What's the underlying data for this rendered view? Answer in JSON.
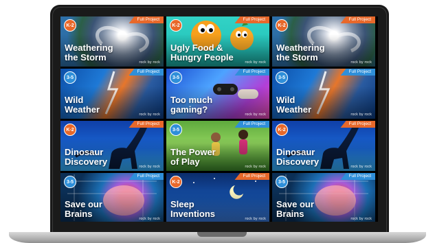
{
  "colors": {
    "ribbon_k2": "#e8682a",
    "ribbon_35": "#2f8fd9",
    "grade_k2": "#e8682a",
    "grade_35": "#2f8fd9"
  },
  "cards": [
    {
      "grade": "K-2",
      "badge": "Full Project",
      "title_line1": "Weathering",
      "title_line2": "the Storm",
      "brand": "rock by rock",
      "theme": "storm"
    },
    {
      "grade": "K-2",
      "badge": "Full Project",
      "title_line1": "Ugly Food &",
      "title_line2": "Hungry People",
      "brand": "rock by rock",
      "theme": "food"
    },
    {
      "grade": "K-2",
      "badge": "Full Project",
      "title_line1": "Weathering",
      "title_line2": "the Storm",
      "brand": "rock by rock",
      "theme": "storm"
    },
    {
      "grade": "3-5",
      "badge": "Full Project",
      "title_line1": "Wild",
      "title_line2": "Weather",
      "brand": "rock by rock",
      "theme": "weather"
    },
    {
      "grade": "3-5",
      "badge": "Full Project",
      "title_line1": "Too much",
      "title_line2": "gaming?",
      "brand": "rock by rock",
      "theme": "gaming"
    },
    {
      "grade": "3-5",
      "badge": "Full Project",
      "title_line1": "Wild",
      "title_line2": "Weather",
      "brand": "rock by rock",
      "theme": "weather"
    },
    {
      "grade": "K-2",
      "badge": "Full Project",
      "title_line1": "Dinosaur",
      "title_line2": "Discovery",
      "brand": "rock by rock",
      "theme": "dino"
    },
    {
      "grade": "3-5",
      "badge": "Full Project",
      "title_line1": "The Power",
      "title_line2": "of Play",
      "brand": "rock by rock",
      "theme": "play"
    },
    {
      "grade": "K-2",
      "badge": "Full Project",
      "title_line1": "Dinosaur",
      "title_line2": "Discovery",
      "brand": "rock by rock",
      "theme": "dino"
    },
    {
      "grade": "3-5",
      "badge": "Full Project",
      "title_line1": "Save our",
      "title_line2": "Brains",
      "brand": "rock by rock",
      "theme": "brain"
    },
    {
      "grade": "K-2",
      "badge": "Full Project",
      "title_line1": "Sleep",
      "title_line2": "Inventions",
      "brand": "rock by rock",
      "theme": "sleep"
    },
    {
      "grade": "3-5",
      "badge": "Full Project",
      "title_line1": "Save our",
      "title_line2": "Brains",
      "brand": "rock by rock",
      "theme": "brain"
    }
  ]
}
